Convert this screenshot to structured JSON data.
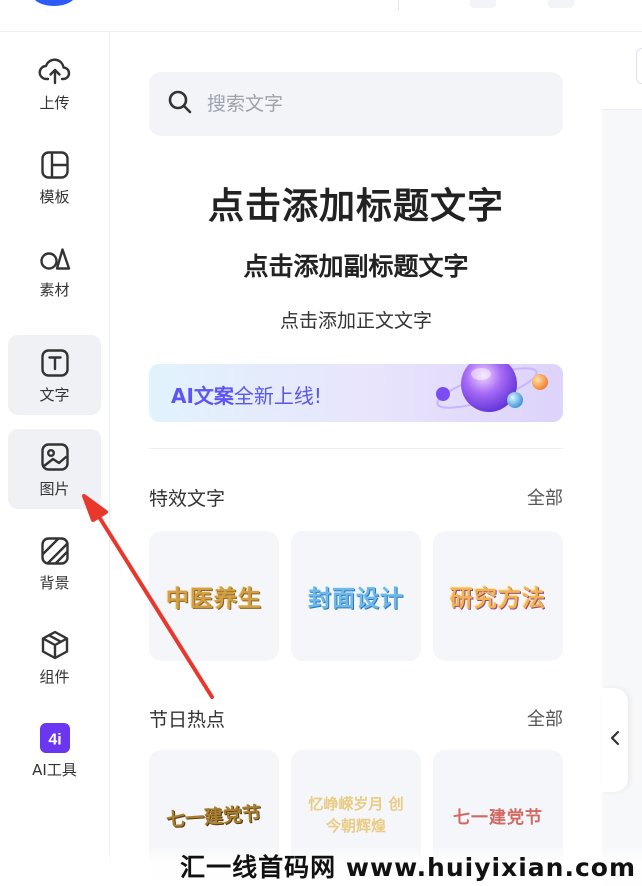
{
  "sidebar": {
    "items": [
      {
        "label": "上传",
        "icon": "upload-cloud-icon"
      },
      {
        "label": "模板",
        "icon": "template-layout-icon"
      },
      {
        "label": "素材",
        "icon": "shapes-icon"
      },
      {
        "label": "文字",
        "icon": "text-t-icon",
        "active": true
      },
      {
        "label": "图片",
        "icon": "image-icon",
        "active": true
      },
      {
        "label": "背景",
        "icon": "background-stripes-icon"
      },
      {
        "label": "组件",
        "icon": "component-cube-icon"
      },
      {
        "label": "AI工具",
        "icon": "ai-badge-icon"
      }
    ]
  },
  "panel": {
    "search": {
      "placeholder": "搜索文字",
      "value": ""
    },
    "add_title": "点击添加标题文字",
    "add_subtitle": "点击添加副标题文字",
    "add_body": "点击添加正文文字",
    "ai_banner": {
      "highlight": "AI文案",
      "rest": "全新上线!"
    },
    "sections": [
      {
        "title": "特效文字",
        "more": "全部",
        "cards": [
          {
            "text": "中医养生",
            "style": "gold"
          },
          {
            "text": "封面设计",
            "style": "blue"
          },
          {
            "text": "研究方法",
            "style": "orange"
          }
        ]
      },
      {
        "title": "节日热点",
        "more": "全部",
        "cards": [
          {
            "text": "七一建党节"
          },
          {
            "text": "忆峥嵘岁月 创今朝辉煌"
          },
          {
            "text": "七一建党节"
          }
        ]
      }
    ]
  },
  "colors": {
    "accent": "#5f55f2",
    "arrow": "#e8372c",
    "nav_active_bg": "#eff1f5"
  },
  "watermark": "汇一线首码网 www.huiyixian.com"
}
